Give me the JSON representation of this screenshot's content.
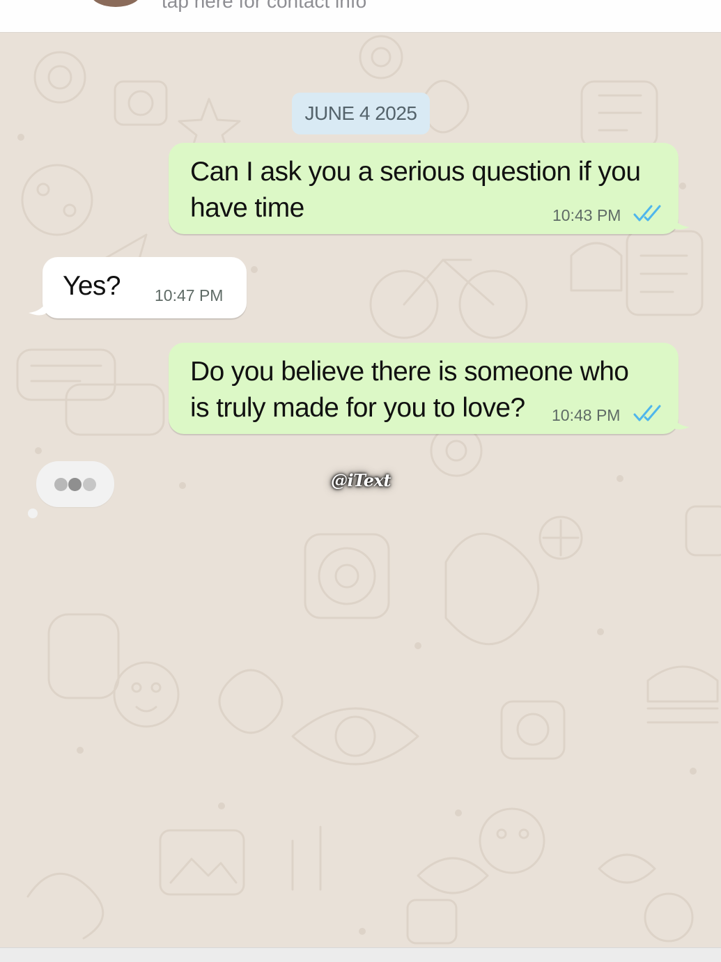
{
  "header": {
    "subtitle": "tap here for contact info"
  },
  "chat": {
    "date_chip": "JUNE 4 2025",
    "messages": [
      {
        "direction": "outgoing",
        "lines": [
          "Can I ask you a serious question if you",
          "have time"
        ],
        "time": "10:43 PM",
        "status": "read"
      },
      {
        "direction": "incoming",
        "lines": [
          "Yes?"
        ],
        "time": "10:47 PM"
      },
      {
        "direction": "outgoing",
        "lines": [
          "Do you believe there is someone who",
          "is truly made for you to love?"
        ],
        "time": "10:48 PM",
        "status": "read"
      }
    ],
    "typing_indicator": {
      "visible": true,
      "dots": 3
    }
  },
  "watermark": "@iText",
  "icons": {
    "double_check": "double-check-icon"
  },
  "colors": {
    "outgoing_bubble": "#dcf8c6",
    "incoming_bubble": "#ffffff",
    "date_chip": "#d9eaf4",
    "chat_background": "#e9e1d8",
    "read_ticks": "#4fb6ec"
  }
}
